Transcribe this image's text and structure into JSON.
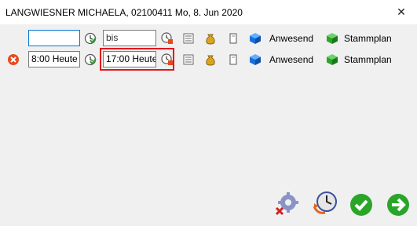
{
  "window": {
    "title": "LANGWIESNER MICHAELA, 02100411 Mo, 8. Jun 2020",
    "close_glyph": "✕"
  },
  "rows": [
    {
      "from_value": "",
      "to_value": "",
      "to_placeholder": "bis",
      "status_label": "Anwesend",
      "plan_label": "Stammplan"
    },
    {
      "from_value": "8:00 Heute",
      "to_value": "17:00 Heute",
      "to_placeholder": "",
      "status_label": "Anwesend",
      "plan_label": "Stammplan"
    }
  ],
  "icons": {
    "clock": "clock-check-icon",
    "clock_stop": "clock-stop-icon",
    "notes": "notes-icon",
    "money": "money-bag-icon",
    "document": "document-icon",
    "cube_blue": "blue-cube-icon",
    "cube_green": "green-cube-icon",
    "delete": "delete-icon"
  },
  "colors": {
    "highlight": "#e2141e",
    "focus_border": "#0078d7",
    "accent_green": "#2aa52a"
  }
}
